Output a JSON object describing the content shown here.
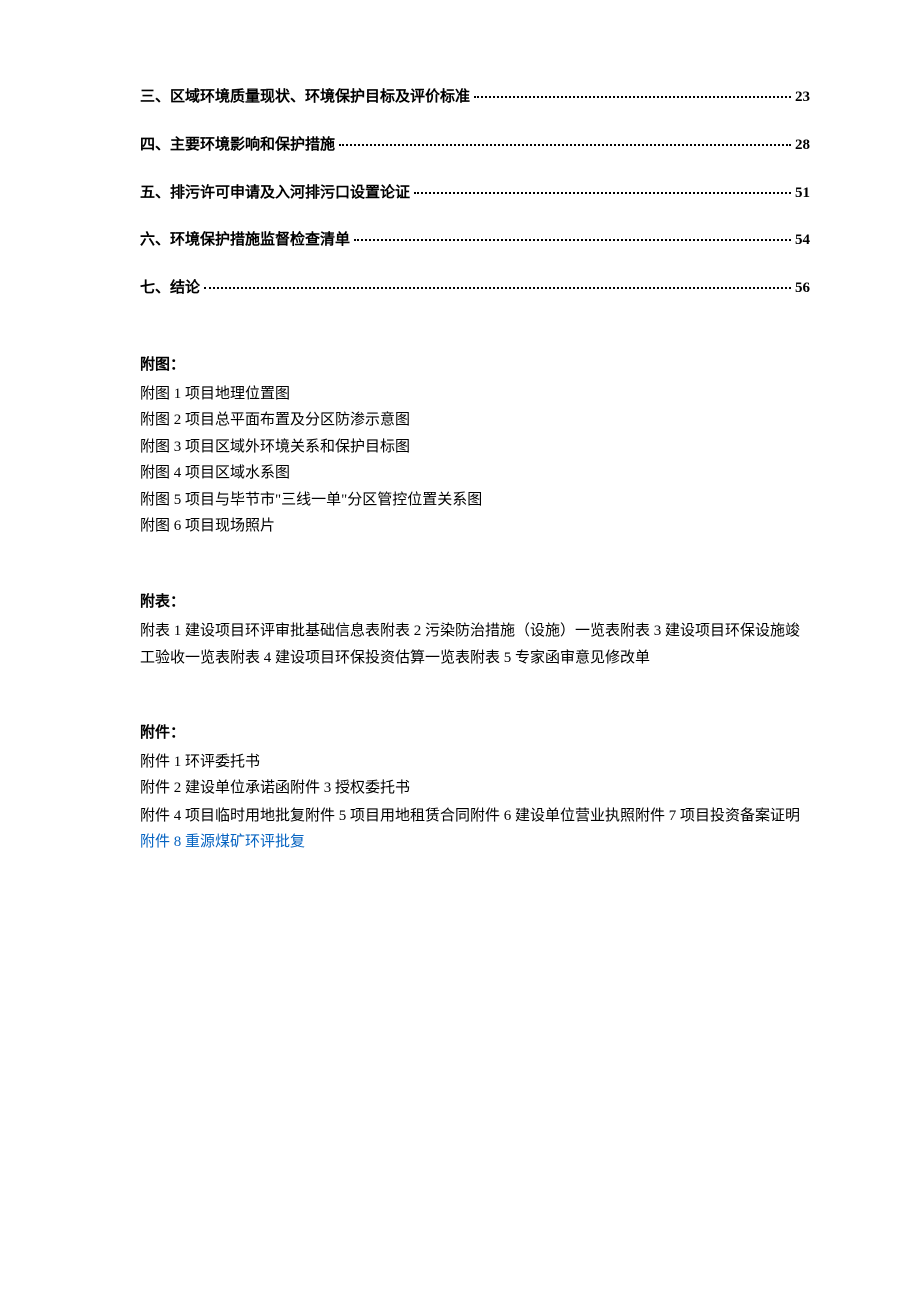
{
  "toc": [
    {
      "label": "三、区域环境质量现状、环境保护目标及评价标准",
      "page": "23"
    },
    {
      "label": "四、主要环境影响和保护措施",
      "page": "28"
    },
    {
      "label": "五、排污许可申请及入河排污口设置论证",
      "page": "51"
    },
    {
      "label": "六、环境保护措施监督检查清单",
      "page": "54"
    },
    {
      "label": "七、结论",
      "page": "56"
    }
  ],
  "figures": {
    "heading": "附图：",
    "items": [
      "附图 1 项目地理位置图",
      "附图 2 项目总平面布置及分区防渗示意图",
      "附图 3 项目区域外环境关系和保护目标图",
      "附图 4 项目区域水系图",
      "附图 5 项目与毕节市\"三线一单\"分区管控位置关系图",
      "附图 6 项目现场照片"
    ]
  },
  "tables": {
    "heading": "附表：",
    "paragraph": "附表 1 建设项目环评审批基础信息表附表 2 污染防治措施（设施）一览表附表 3 建设项目环保设施竣工验收一览表附表 4 建设项目环保投资估算一览表附表 5 专家函审意见修改单"
  },
  "attachments": {
    "heading": "附件：",
    "lines": [
      "附件 1 环评委托书",
      "附件 2 建设单位承诺函附件 3 授权委托书",
      "附件 4 项目临时用地批复附件 5 项目用地租赁合同附件 6 建设单位营业执照附件 7 项目投资备案证明"
    ],
    "link_line": "附件 8 重源煤矿环评批复"
  }
}
